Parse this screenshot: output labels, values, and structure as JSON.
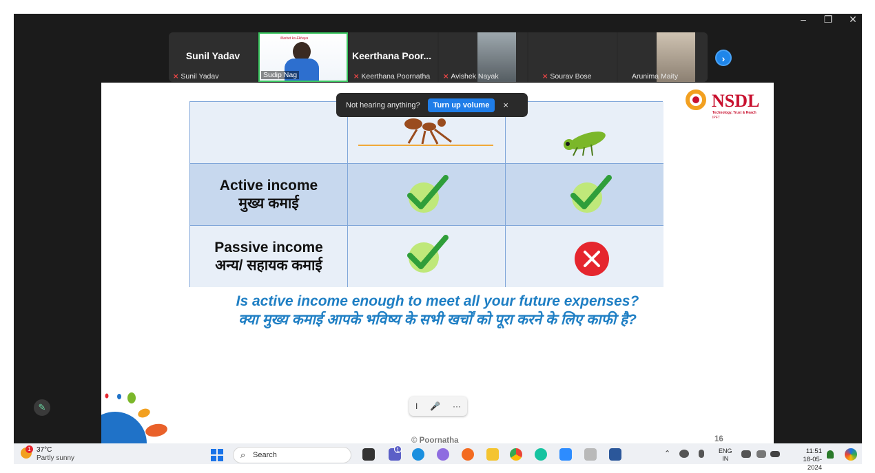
{
  "window": {
    "minimize_label": "–",
    "restore_label": "❐",
    "close_label": "✕"
  },
  "participants": {
    "tiles": [
      {
        "big_name": "Sunil Yadav",
        "name": "Sunil Yadav",
        "muted": true
      },
      {
        "big_name": "",
        "name": "Sudip Nag",
        "muted": false,
        "speaking": true
      },
      {
        "big_name": "Keerthana  Poor...",
        "name": "Keerthana Poornatha",
        "muted": true
      },
      {
        "big_name": "",
        "name": "Avishek Nayak",
        "muted": true
      },
      {
        "big_name": "",
        "name": "Sourav Bose",
        "muted": true
      },
      {
        "big_name": "",
        "name": "Arunima Maity",
        "muted": false
      }
    ],
    "next_icon": "chevron-right-icon",
    "speaker_banner": "Market ka Ekbaya"
  },
  "slide": {
    "logo_text": "NSDL",
    "logo_tagline": "Technology, Trust & Reach",
    "logo_sub": "IPFT",
    "table": {
      "rows": [
        {
          "en": "Active income",
          "hi": "मुख्य  कमाई",
          "ant": "check",
          "grasshopper": "check"
        },
        {
          "en": "Passive income",
          "hi": "अन्य/ सहायक कमाई",
          "ant": "check",
          "grasshopper": "cross"
        }
      ]
    },
    "question_en": "Is active income enough to meet all your future expenses?",
    "question_hi": "क्या मुख्य कमाई आपके भविष्य के सभी खर्चों को पूरा करने के लिए काफी है?",
    "copyright": "© Poornatha",
    "page_number": "16"
  },
  "toast": {
    "message": "Not hearing anything?",
    "button": "Turn up volume",
    "close": "×"
  },
  "annotation_bar": {
    "items": [
      "I",
      "🎤",
      "···"
    ]
  },
  "taskbar": {
    "weather_temp": "37°C",
    "weather_desc": "Partly sunny",
    "weather_badge": "1",
    "search_placeholder": "Search",
    "teams_badge": "1",
    "lang_top": "ENG",
    "lang_bottom": "IN",
    "time": "11:51",
    "date": "18-05-2024"
  },
  "colors": {
    "accent": "#1f7de8",
    "check_green": "#2f9e3a",
    "cross_red": "#e5262e",
    "question_blue": "#1f7fc4",
    "nsdl_red": "#c8102e"
  }
}
